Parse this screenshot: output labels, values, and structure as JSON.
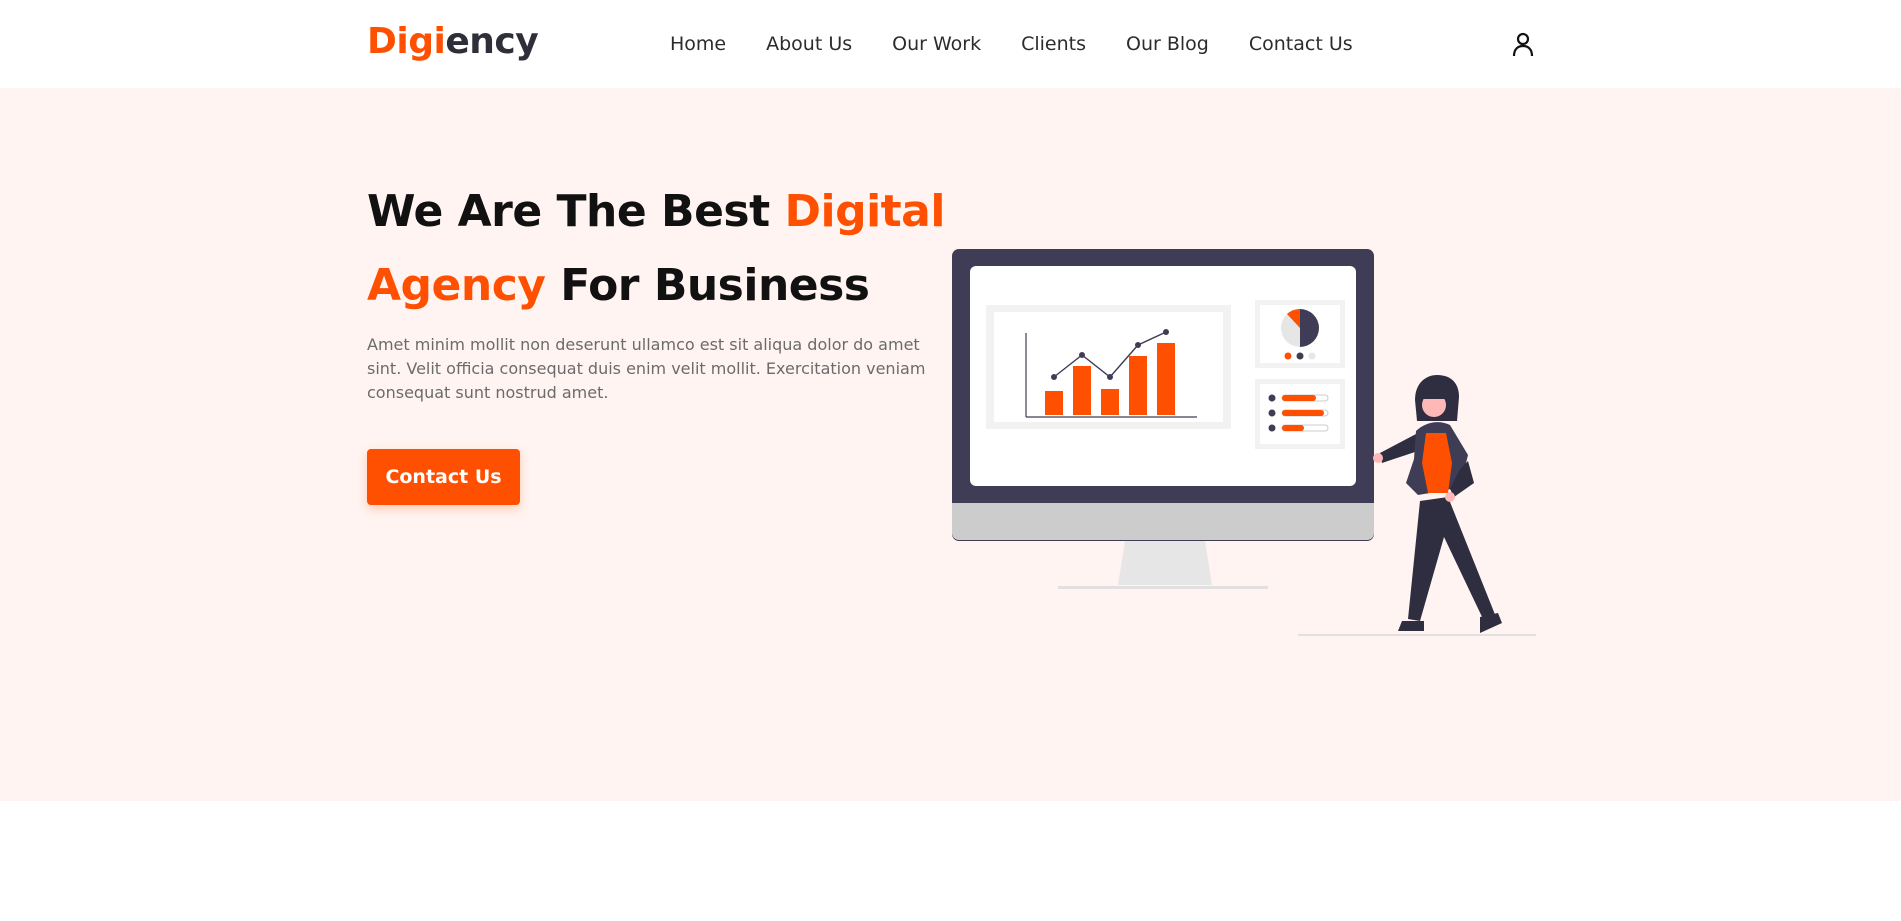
{
  "brand": {
    "logo_part1": "Digi",
    "logo_part2": "ency",
    "accent_color": "#fe5000",
    "dark_color": "#2f2f3a",
    "hero_bg": "#fff4f1"
  },
  "nav": {
    "items": [
      {
        "label": "Home"
      },
      {
        "label": "About Us"
      },
      {
        "label": "Our Work"
      },
      {
        "label": "Clients"
      },
      {
        "label": "Our Blog"
      },
      {
        "label": "Contact Us"
      }
    ]
  },
  "header": {
    "user_icon": "user-icon"
  },
  "hero": {
    "headline_part1": "We Are The Best ",
    "headline_highlight": "Digital Agency",
    "headline_part2": " For Business",
    "description": "Amet minim mollit non deserunt ullamco est sit aliqua dolor do amet sint. Velit officia consequat duis enim velit mollit. Exercitation veniam consequat sunt nostrud amet.",
    "cta_label": "Contact Us"
  }
}
